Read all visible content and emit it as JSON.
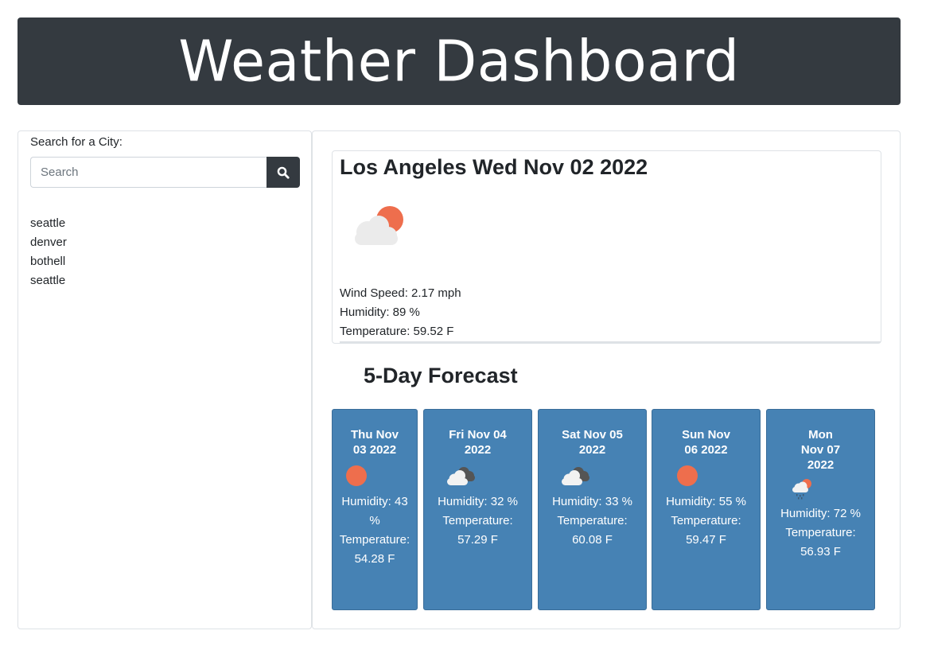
{
  "header": {
    "title": "Weather Dashboard"
  },
  "search": {
    "label": "Search for a City:",
    "placeholder": "Search",
    "value": ""
  },
  "history": [
    "seattle",
    "denver",
    "bothell",
    "seattle"
  ],
  "current": {
    "title": "Los Angeles Wed Nov 02 2022",
    "icon": "partly-cloudy-sun-icon",
    "wind": "Wind Speed: 2.17 mph",
    "humidity": "Humidity: 89 %",
    "temperature": "Temperature: 59.52 F"
  },
  "forecast": {
    "title": "5-Day Forecast",
    "days": [
      {
        "date": "Thu Nov 03 2022",
        "icon": "sun-icon",
        "humidity": "Humidity: 43 %",
        "temperature": "Temperature: 54.28 F"
      },
      {
        "date": "Fri Nov 04 2022",
        "icon": "broken-clouds-icon",
        "humidity": "Humidity: 32 %",
        "temperature": "Temperature: 57.29 F"
      },
      {
        "date": "Sat Nov 05 2022",
        "icon": "broken-clouds-icon",
        "humidity": "Humidity: 33 %",
        "temperature": "Temperature: 60.08 F"
      },
      {
        "date": "Sun Nov 06 2022",
        "icon": "sun-icon",
        "humidity": "Humidity: 55 %",
        "temperature": "Temperature: 59.47 F"
      },
      {
        "date": "Mon Nov 07 2022",
        "icon": "rain-sun-icon",
        "humidity": "Humidity: 72 %",
        "temperature": "Temperature: 56.93 F"
      }
    ]
  },
  "colors": {
    "header_bg": "#343a40",
    "card_bg": "#4682b4",
    "sun": "#ee6e4d"
  }
}
